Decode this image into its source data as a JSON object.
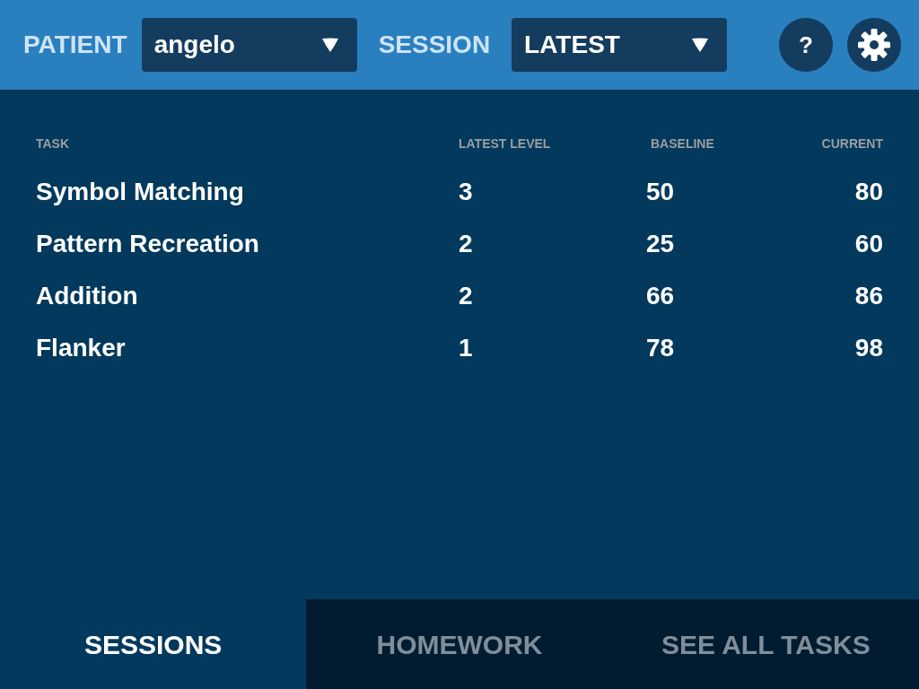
{
  "header": {
    "patient_label": "PATIENT",
    "patient_select": {
      "value": "angelo"
    },
    "session_label": "SESSION",
    "session_select": {
      "value": "LATEST"
    },
    "help_button": "?"
  },
  "table": {
    "columns": [
      "TASK",
      "LATEST LEVEL",
      "BASELINE",
      "CURRENT"
    ],
    "rows": [
      [
        "Symbol Matching",
        "3",
        "50",
        "80"
      ],
      [
        "Pattern Recreation",
        "2",
        "25",
        "60"
      ],
      [
        "Addition",
        "2",
        "66",
        "86"
      ],
      [
        "Flanker",
        "1",
        "78",
        "98"
      ]
    ]
  },
  "tabs": [
    {
      "label": "SESSIONS",
      "selected": true
    },
    {
      "label": "HOMEWORK",
      "selected": false
    },
    {
      "label": "SEE ALL TASKS",
      "selected": false
    }
  ]
}
